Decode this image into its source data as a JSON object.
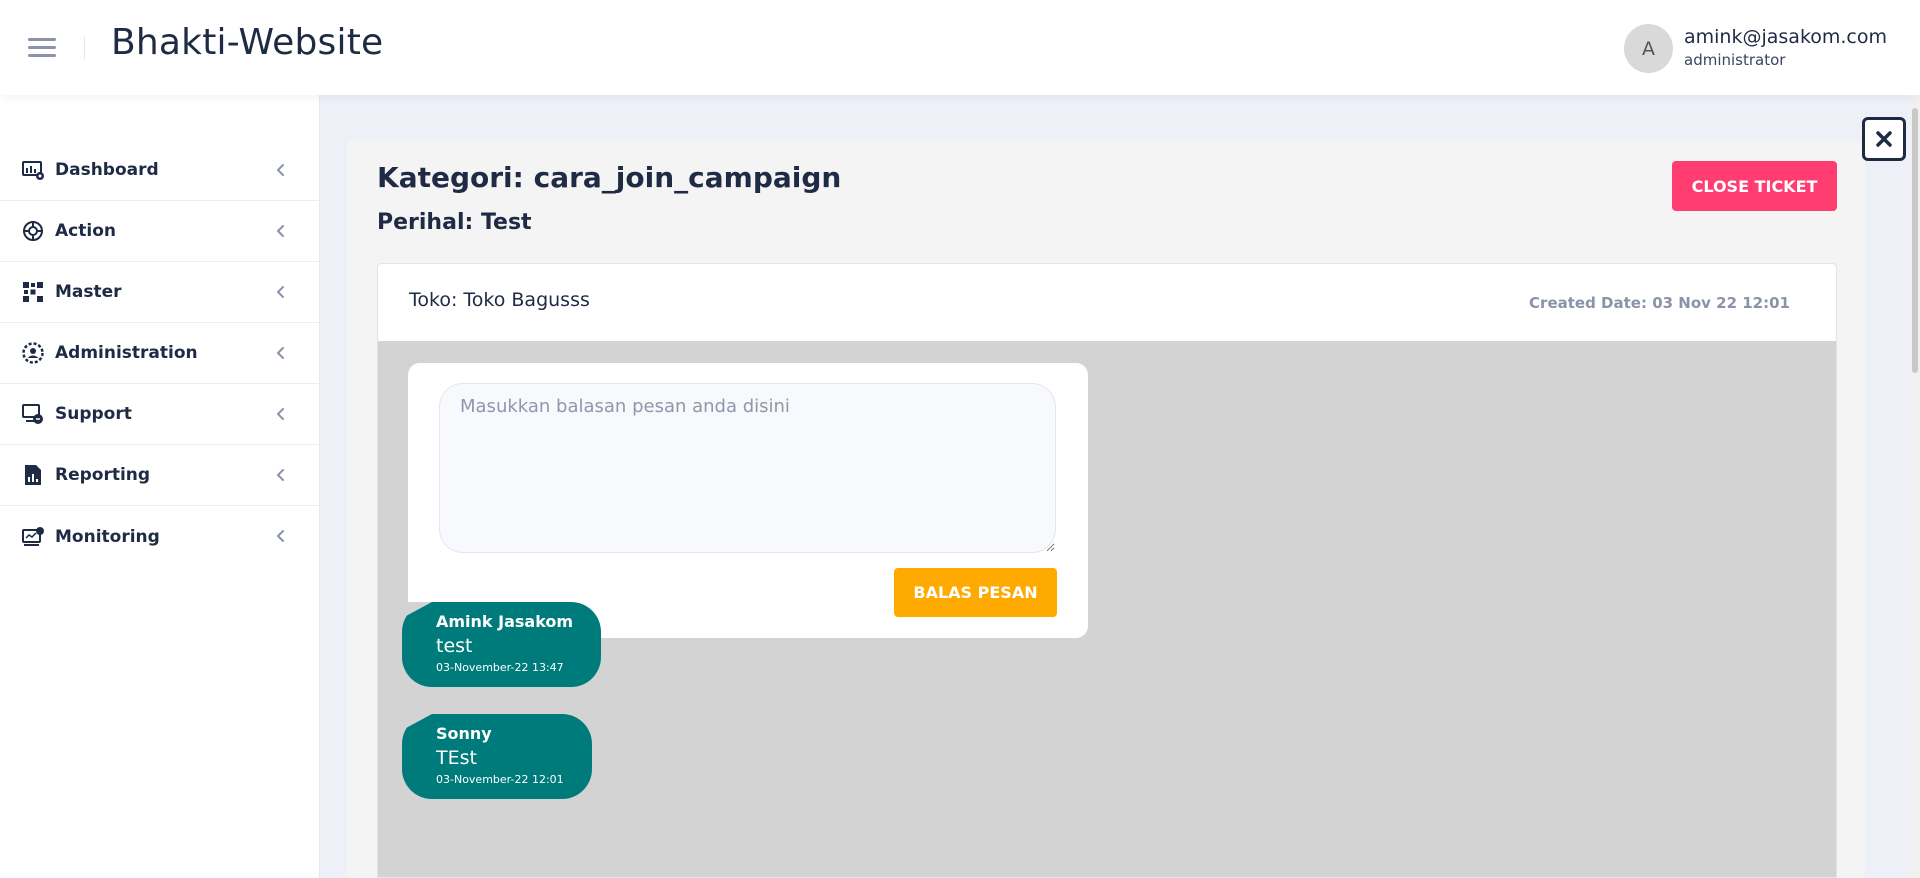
{
  "header": {
    "app_title": "Bhakti-Website",
    "user": {
      "avatar_initial": "A",
      "email": "amink@jasakom.com",
      "role": "administrator"
    }
  },
  "sidebar": {
    "items": [
      {
        "label": "Dashboard",
        "icon": "dashboard-icon"
      },
      {
        "label": "Action",
        "icon": "action-icon"
      },
      {
        "label": "Master",
        "icon": "master-icon"
      },
      {
        "label": "Administration",
        "icon": "administration-icon"
      },
      {
        "label": "Support",
        "icon": "support-icon"
      },
      {
        "label": "Reporting",
        "icon": "reporting-icon"
      },
      {
        "label": "Monitoring",
        "icon": "monitoring-icon"
      }
    ]
  },
  "ticket": {
    "kategori": "Kategori: cara_join_campaign",
    "perihal": "Perihal: Test",
    "close_button_label": "CLOSE TICKET",
    "toko": "Toko: Toko Bagusss",
    "created_date": "Created Date: 03 Nov 22 12:01",
    "reply_placeholder": "Masukkan balasan pesan anda disini",
    "reply_value": "",
    "reply_button_label": "BALAS PESAN",
    "messages": [
      {
        "author": "Amink Jasakom",
        "text": "test",
        "time": "03-November-22 13:47"
      },
      {
        "author": "Sonny",
        "text": "TEst",
        "time": "03-November-22 12:01"
      }
    ]
  },
  "colors": {
    "accent_pink": "#ff3d71",
    "accent_orange": "#ffaa00",
    "message_bubble": "#007b7b",
    "panel_gray": "#d3d3d3"
  }
}
